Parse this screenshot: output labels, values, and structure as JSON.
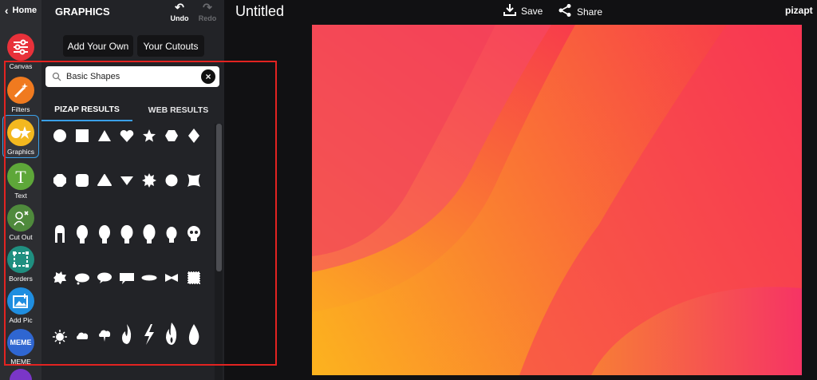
{
  "rail": {
    "home_label": "Home",
    "tools": [
      {
        "label": "Canvas",
        "color": "#e8313a",
        "icon": "sliders-icon"
      },
      {
        "label": "Filters",
        "color": "#f07a1f",
        "icon": "magic-wand-icon"
      },
      {
        "label": "Graphics",
        "color": "#f3b81f",
        "icon": "shapes-icon"
      },
      {
        "label": "Text",
        "color": "#5ea739",
        "icon": "text-t-icon"
      },
      {
        "label": "Cut Out",
        "color": "#4f8a3c",
        "icon": "cutout-person-icon"
      },
      {
        "label": "Borders",
        "color": "#1f8f80",
        "icon": "border-frame-icon"
      },
      {
        "label": "Add Pic",
        "color": "#1f8ee0",
        "icon": "add-picture-icon"
      },
      {
        "label": "MEME",
        "color": "#2f66d1",
        "icon": "meme-icon"
      }
    ]
  },
  "panel": {
    "title": "GRAPHICS",
    "undo": "Undo",
    "redo": "Redo",
    "add_your_own": "Add Your Own",
    "your_cutouts": "Your Cutouts",
    "search_value": "Basic Shapes",
    "tabs": [
      "PIZAP RESULTS",
      "WEB RESULTS"
    ],
    "results": [
      [
        "circle",
        "square",
        "triangle",
        "heart",
        "star",
        "hexagon",
        "diamond"
      ],
      [
        "octagon",
        "rounded-square",
        "triangle-rounded",
        "inverted-triangle",
        "burst",
        "circle-small",
        "four-point-star"
      ],
      [
        "head-long-hair",
        "head-1",
        "head-2",
        "head-3",
        "head-4",
        "head-5",
        "skull"
      ],
      [
        "speech-burst",
        "thought-cloud",
        "speech-oval",
        "speech-rect",
        "oval-spiky",
        "bowtie-speech",
        "stamp"
      ],
      [
        "sun",
        "cloud",
        "storm-cloud",
        "flame",
        "lightning-bolt",
        "fire",
        "water-drop"
      ]
    ]
  },
  "topbar": {
    "title": "Untitled",
    "save": "Save",
    "share": "Share",
    "brand": "pizapt"
  },
  "colors": {
    "accent": "#3aa0e8",
    "selection": "#e32321",
    "gradient_start": "#fdb71d",
    "gradient_end": "#f7175a"
  }
}
